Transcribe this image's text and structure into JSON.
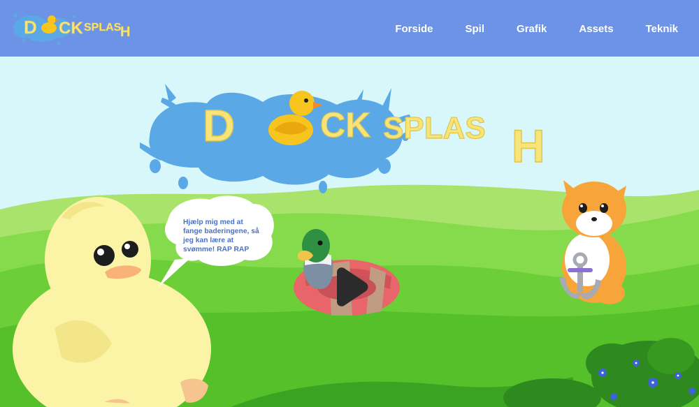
{
  "site": {
    "logo_text": "Duck Splash"
  },
  "nav": {
    "items": [
      {
        "label": "Forside"
      },
      {
        "label": "Spil"
      },
      {
        "label": "Grafik"
      },
      {
        "label": "Assets"
      },
      {
        "label": "Teknik"
      }
    ]
  },
  "hero": {
    "title": "Duck Splash",
    "speech_text": "Hjælp mig med at fange baderingene, så jeg kan lære at svømme! RAP RAP"
  },
  "colors": {
    "nav_bg": "#6c93e6",
    "sky": "#d8f7fb",
    "title_yellow": "#f7e57a",
    "splash_blue": "#5aa9e6",
    "grass_light": "#a9e36b",
    "grass_mid": "#6ccf37",
    "grass_dark": "#3aa322"
  }
}
